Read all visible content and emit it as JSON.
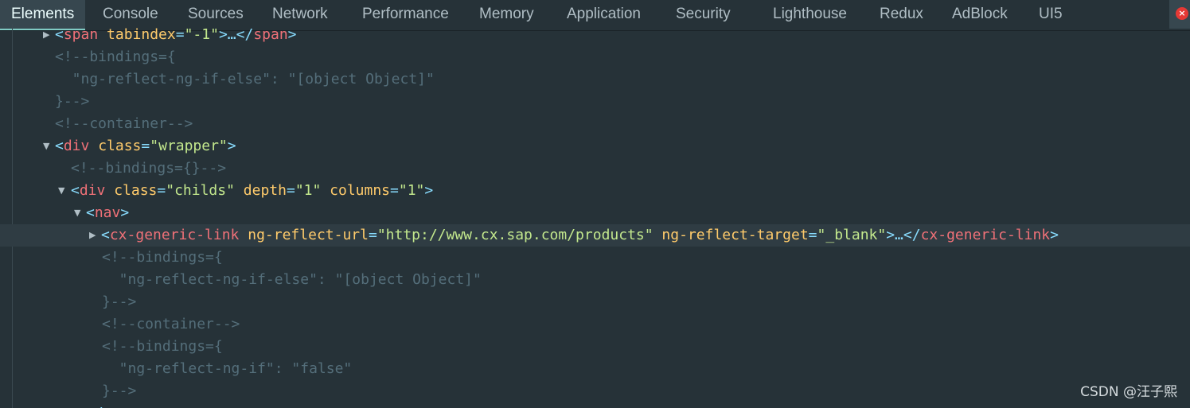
{
  "tabs": [
    {
      "label": "Elements",
      "active": true
    },
    {
      "label": "Console"
    },
    {
      "label": "Sources"
    },
    {
      "label": "Network"
    },
    {
      "label": "Performance"
    },
    {
      "label": "Memory"
    },
    {
      "label": "Application"
    },
    {
      "label": "Security"
    },
    {
      "label": "Lighthouse"
    },
    {
      "label": "Redux"
    },
    {
      "label": "AdBlock"
    },
    {
      "label": "UI5"
    }
  ],
  "close_label": "×",
  "dom": [
    {
      "arrow": "▶",
      "tokens": [
        [
          "p",
          "<"
        ],
        [
          "t",
          "span"
        ],
        [
          "a",
          " tabindex"
        ],
        [
          "p",
          "="
        ],
        [
          "v",
          "\"-1\""
        ],
        [
          "p",
          ">…</"
        ],
        [
          "t",
          "span"
        ],
        [
          "p",
          ">"
        ]
      ]
    },
    {
      "tokens": [
        [
          "c",
          "<!--bindings={"
        ]
      ]
    },
    {
      "tokens": [
        [
          "c",
          "  \"ng-reflect-ng-if-else\": \"[object Object]\""
        ]
      ]
    },
    {
      "tokens": [
        [
          "c",
          "}-->"
        ]
      ]
    },
    {
      "tokens": [
        [
          "c",
          "<!--container-->"
        ]
      ]
    },
    {
      "arrow": "▼",
      "tokens": [
        [
          "p",
          "<"
        ],
        [
          "t",
          "div"
        ],
        [
          "a",
          " class"
        ],
        [
          "p",
          "="
        ],
        [
          "v",
          "\"wrapper\""
        ],
        [
          "p",
          ">"
        ]
      ]
    },
    {
      "tokens": [
        [
          "c",
          "<!--bindings={}-->"
        ]
      ]
    },
    {
      "arrow": "▼",
      "tokens": [
        [
          "p",
          "<"
        ],
        [
          "t",
          "div"
        ],
        [
          "a",
          " class"
        ],
        [
          "p",
          "="
        ],
        [
          "v",
          "\"childs\""
        ],
        [
          "a",
          " depth"
        ],
        [
          "p",
          "="
        ],
        [
          "v",
          "\"1\""
        ],
        [
          "a",
          " columns"
        ],
        [
          "p",
          "="
        ],
        [
          "v",
          "\"1\""
        ],
        [
          "p",
          ">"
        ]
      ]
    },
    {
      "arrow": "▼",
      "tokens": [
        [
          "p",
          "<"
        ],
        [
          "t",
          "nav"
        ],
        [
          "p",
          ">"
        ]
      ]
    },
    {
      "arrow": "▶",
      "selected": true,
      "tokens": [
        [
          "p",
          "<"
        ],
        [
          "t",
          "cx-generic-link"
        ],
        [
          "a",
          " ng-reflect-url"
        ],
        [
          "p",
          "="
        ],
        [
          "v",
          "\"http://www.cx.sap.com/products\""
        ],
        [
          "a",
          " ng-reflect-target"
        ],
        [
          "p",
          "="
        ],
        [
          "v",
          "\"_blank\""
        ],
        [
          "p",
          ">…</"
        ],
        [
          "t",
          "cx-generic-link"
        ],
        [
          "p",
          ">"
        ]
      ]
    },
    {
      "tokens": [
        [
          "c",
          "<!--bindings={"
        ]
      ]
    },
    {
      "tokens": [
        [
          "c",
          "  \"ng-reflect-ng-if-else\": \"[object Object]\""
        ]
      ]
    },
    {
      "tokens": [
        [
          "c",
          "}-->"
        ]
      ]
    },
    {
      "tokens": [
        [
          "c",
          "<!--container-->"
        ]
      ]
    },
    {
      "tokens": [
        [
          "c",
          "<!--bindings={"
        ]
      ]
    },
    {
      "tokens": [
        [
          "c",
          "  \"ng-reflect-ng-if\": \"false\""
        ]
      ]
    },
    {
      "tokens": [
        [
          "c",
          "}-->"
        ]
      ]
    },
    {
      "tokens": [
        [
          "p",
          "</"
        ],
        [
          "t",
          "nav"
        ],
        [
          "p",
          ">"
        ]
      ]
    }
  ],
  "watermark": "CSDN @汪子熙"
}
